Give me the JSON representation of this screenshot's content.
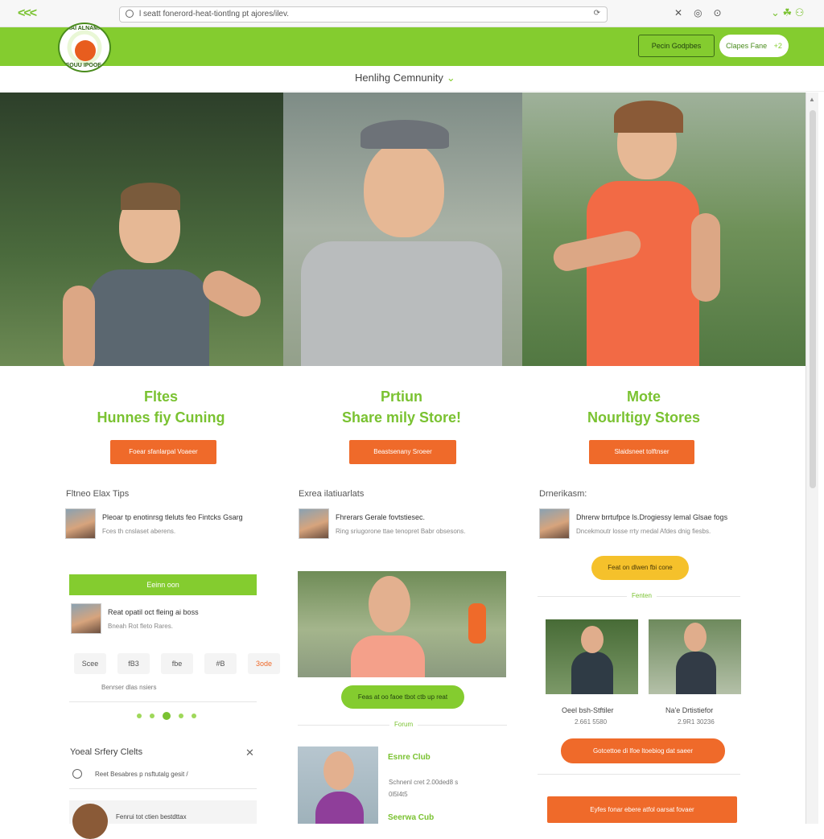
{
  "browser": {
    "nav_arrows": "<<<",
    "address": "l seatt fonerord-heat-tiontlng pt ajores/ilev.",
    "reload": "⟳"
  },
  "header": {
    "logo_ring_text": "RIHAI ALNAMAS",
    "logo_bottom_text": "FOUU IPOOE",
    "outline_button": "Pecin Godpbes",
    "white_button": "Clapes Fane",
    "white_button_suffix": "+2"
  },
  "subnav": {
    "title": "Henlihg Cemnunity",
    "chevron": "⌄"
  },
  "features": [
    {
      "line1": "Fltes",
      "line2": "Hunnes fiy Cuning",
      "button": "Foear sfanlarpal Voaeer"
    },
    {
      "line1": "Prtiun",
      "line2": "Share mily Store!",
      "button": "Beastsenany Sroeer"
    },
    {
      "line1": "Mote",
      "line2": "Nourltigy Stores",
      "button": "Slaidsneet tolftnser"
    }
  ],
  "col1": {
    "heading": "Fltneo Elax Tips",
    "item": {
      "t1": "Pleoar tp enotinrsg tleluts feo Fintcks Gsarg",
      "t2": "Fces th cnslaset aberens."
    },
    "bar": "Eeinn oon",
    "item2": {
      "t1": "Reat opatil oct fleing ai boss",
      "t2": "Bneah Rot fleto Rares."
    },
    "chips": [
      "Scee",
      "fB3",
      "fbe",
      "#B",
      "3ode"
    ],
    "chip_caption": "Benrser dlas nsiers",
    "friends_heading": "Yoeal Srfery Clelts",
    "friends_search": "Reet Besabres p nsftutalg gesit /",
    "friends_item": "Fenrui tot ctien bestdttax",
    "close": "✕"
  },
  "col2": {
    "heading": "Exrea ilatiuarlats",
    "item": {
      "t1": "Fhrerars Gerale fovtstiesec.",
      "t2": "Ring sriugorone ttae tenopret Babr obsesons."
    },
    "pill": "Feas at oo faoe tbot ctb up reat",
    "divider": "Forum",
    "club1": "Esnre Club",
    "meta1": "Schnenl cret    2.00ded8 s",
    "meta2": "0l5l4t5",
    "club2": "Seerwa Cub"
  },
  "col3": {
    "heading": "Drnerikasm:",
    "item": {
      "t1": "Dhrerw brrtufpce ls.Drogiessy lemal Glsae fogs",
      "t2": "Dncekmoutr losse rrty rnedal Afdes dnig fiesbs."
    },
    "pill": "Feat on dlwen fbi cone",
    "divider": "Fenten",
    "runner1": "Oeel bsh-Stftiler",
    "runner1_meta": "2.661 5580",
    "runner2": "Na'e Drtistiefor",
    "runner2_meta": "2.9R1 30236",
    "pill2": "Gotcettoe di lfoe ltoebiog dat saeer",
    "bottom_button": "Eyfes fonar ebere atfol oarsat fovaer"
  },
  "colors": {
    "green": "#84cc2f",
    "orange": "#ef6a2a",
    "yellow": "#f5c12b"
  }
}
